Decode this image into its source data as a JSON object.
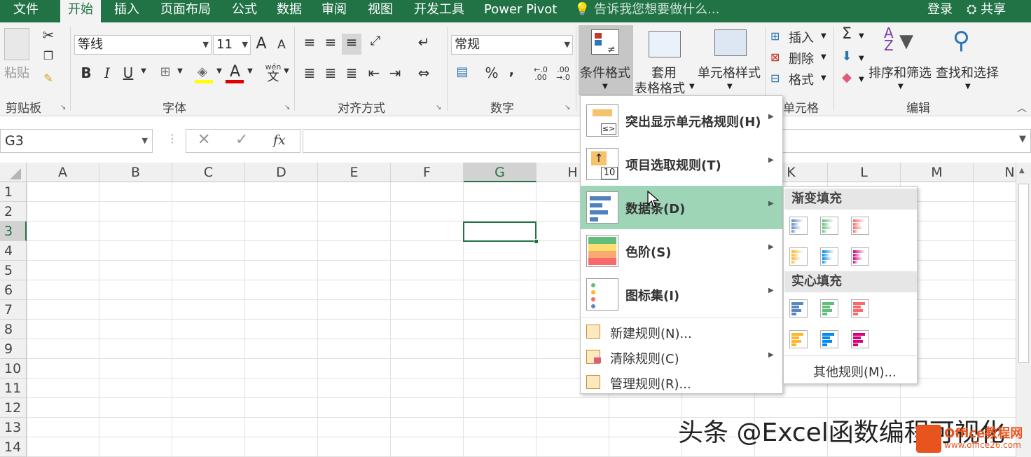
{
  "tabs": [
    "文件",
    "开始",
    "插入",
    "页面布局",
    "公式",
    "数据",
    "审阅",
    "视图",
    "开发工具",
    "Power Pivot"
  ],
  "active_tab": "开始",
  "tell_me": "告诉我您想要做什么...",
  "login": "登录",
  "share": "共享",
  "ribbon": {
    "clipboard": {
      "paste": "粘贴",
      "group": "剪贴板"
    },
    "font": {
      "name": "等线",
      "size": "11",
      "group": "字体",
      "grow": "A",
      "shrink": "A",
      "bold": "B",
      "italic": "I",
      "underline": "U",
      "wen": "wén",
      "wen2": "文"
    },
    "align": {
      "group": "对齐方式"
    },
    "number": {
      "format": "常规",
      "percent": "%",
      "comma": "‚",
      "group": "数字",
      "inc": "←.0\n.00",
      "dec": ".00\n→.0"
    },
    "styles": {
      "cond_format": "条件格式",
      "table_style_1": "套用",
      "table_style_2": "表格格式",
      "cell_style": "单元格样式"
    },
    "cells": {
      "insert": "插入",
      "delete": "删除",
      "format": "格式",
      "group": "单元格"
    },
    "editing": {
      "sort": "排序和筛选",
      "find": "查找和选择",
      "group": "编辑",
      "sum": "Σ"
    }
  },
  "name_box": "G3",
  "fx": "fx",
  "columns": [
    "A",
    "B",
    "C",
    "D",
    "E",
    "F",
    "G",
    "H",
    "I",
    "J",
    "K",
    "L",
    "M",
    "N"
  ],
  "rows": [
    "1",
    "2",
    "3",
    "4",
    "5",
    "6",
    "7",
    "8",
    "9",
    "10",
    "11",
    "12",
    "13",
    "14"
  ],
  "menu": {
    "items": [
      {
        "label": "突出显示单元格规则(H)"
      },
      {
        "label": "项目选取规则(T)"
      },
      {
        "label": "数据条(D)"
      },
      {
        "label": "色阶(S)"
      },
      {
        "label": "图标集(I)"
      }
    ],
    "small": [
      {
        "label": "新建规则(N)..."
      },
      {
        "label": "清除规则(C)"
      },
      {
        "label": "管理规则(R)..."
      }
    ],
    "top10_num": "10"
  },
  "submenu": {
    "gradient": "渐变填充",
    "solid": "实心填充",
    "more": "其他规则(M)...",
    "colors": [
      "#5b87c5",
      "#63be7b",
      "#f8696b",
      "#ffb628",
      "#008aef",
      "#d6007b"
    ]
  },
  "watermark": {
    "text": "头条 @Excel函数编程可视化",
    "logo_text": "Office教程网",
    "logo_url": "www.office26.com"
  }
}
